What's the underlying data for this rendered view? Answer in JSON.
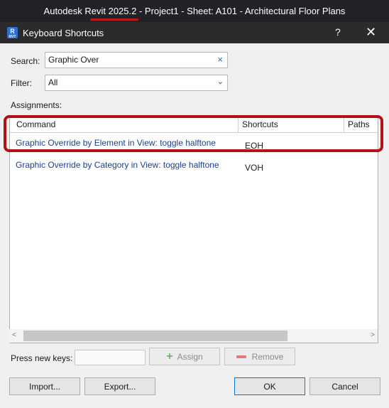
{
  "app": {
    "title": "Autodesk Revit 2025.2 - Project1 - Sheet: A101 - Architectural Floor Plans"
  },
  "dialog": {
    "title": "Keyboard Shortcuts",
    "help": "?",
    "close": "✕",
    "icon_letter": "R",
    "icon_sub": "RVT"
  },
  "search": {
    "label": "Search:",
    "value": "Graphic Over",
    "clear": "×"
  },
  "filter": {
    "label": "Filter:",
    "value": "All"
  },
  "assignments": {
    "label": "Assignments:",
    "columns": [
      "Command",
      "Shortcuts",
      "Paths"
    ],
    "rows": [
      {
        "command": "Graphic Override by Element in View: toggle halftone",
        "shortcut": "EOH"
      },
      {
        "command": "Graphic Override by Category in View: toggle halftone",
        "shortcut": "VOH"
      }
    ]
  },
  "press_keys": {
    "label": "Press new keys:",
    "value": ""
  },
  "buttons": {
    "assign": "Assign",
    "remove": "Remove",
    "import": "Import...",
    "export": "Export...",
    "ok": "OK",
    "cancel": "Cancel"
  }
}
